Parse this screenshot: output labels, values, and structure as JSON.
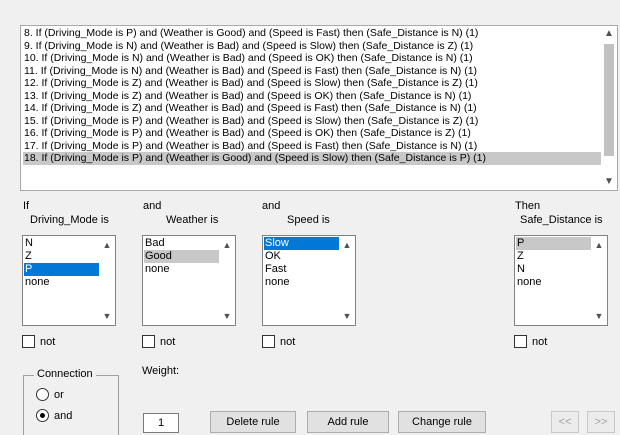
{
  "rules": [
    "8. If (Driving_Mode is P) and (Weather is Good) and (Speed is Fast) then (Safe_Distance is N) (1)",
    "9. If (Driving_Mode is N) and (Weather is Bad) and (Speed is Slow) then (Safe_Distance is Z) (1)",
    "10. If (Driving_Mode is N) and (Weather is Bad) and (Speed is OK) then (Safe_Distance is N) (1)",
    "11. If (Driving_Mode is N) and (Weather is Bad) and (Speed is Fast) then (Safe_Distance is N) (1)",
    "12. If (Driving_Mode is Z) and (Weather is Bad) and (Speed is Slow) then (Safe_Distance is Z) (1)",
    "13. If (Driving_Mode is Z) and (Weather is Bad) and (Speed is OK) then (Safe_Distance is N) (1)",
    "14. If (Driving_Mode is Z) and (Weather is Bad) and (Speed is Fast) then (Safe_Distance is N) (1)",
    "15. If (Driving_Mode is P) and (Weather is Bad) and (Speed is Slow) then (Safe_Distance is Z) (1)",
    "16. If (Driving_Mode is P) and (Weather is Bad) and (Speed is OK) then (Safe_Distance is Z) (1)",
    "17. If (Driving_Mode is P) and (Weather is Bad) and (Speed is Fast) then (Safe_Distance is N) (1)",
    "18. If (Driving_Mode is P) and (Weather is Good) and (Speed is Slow) then (Safe_Distance is P) (1)"
  ],
  "selected_rule_index": 10,
  "if_label": "If",
  "and_label_1": "and",
  "and_label_2": "and",
  "then_label": "Then",
  "driving_mode": {
    "title": "Driving_Mode is",
    "items": [
      "N",
      "Z",
      "P",
      "none"
    ],
    "selected": 2,
    "not_label": "not"
  },
  "weather": {
    "title": "Weather is",
    "items": [
      "Bad",
      "Good",
      "none"
    ],
    "selected": 1,
    "not_label": "not"
  },
  "speed": {
    "title": "Speed is",
    "items": [
      "Slow",
      "OK",
      "Fast",
      "none"
    ],
    "selected": 0,
    "not_label": "not"
  },
  "safe_distance": {
    "title": "Safe_Distance is",
    "items": [
      "P",
      "Z",
      "N",
      "none"
    ],
    "selected": 0,
    "not_label": "not"
  },
  "connection": {
    "title": "Connection",
    "or_label": "or",
    "and_label": "and",
    "selected": "and"
  },
  "weight": {
    "label": "Weight:",
    "value": "1"
  },
  "buttons": {
    "delete_rule": "Delete rule",
    "add_rule": "Add rule",
    "change_rule": "Change rule",
    "prev": "<<",
    "next": ">>"
  },
  "colors": {
    "selection_blue": "#0078d7",
    "selection_gray": "#c8c8c8"
  }
}
